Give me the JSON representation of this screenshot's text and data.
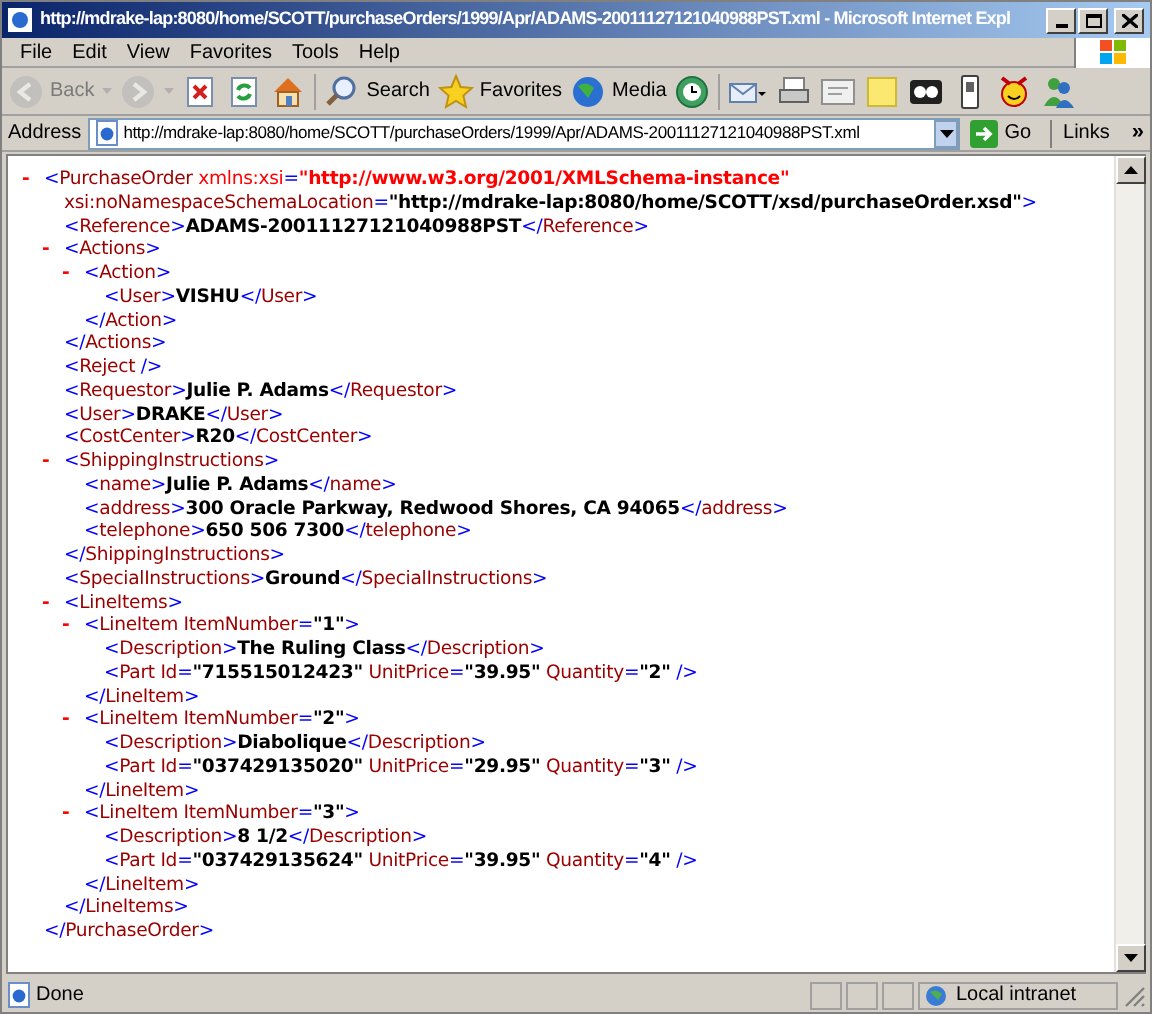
{
  "window": {
    "title": "http://mdrake-lap:8080/home/SCOTT/purchaseOrders/1999/Apr/ADAMS-20011127121040988PST.xml - Microsoft Internet Expl"
  },
  "menu": [
    "File",
    "Edit",
    "View",
    "Favorites",
    "Tools",
    "Help"
  ],
  "toolbar": [
    {
      "kind": "back",
      "label": "Back",
      "disabled": true
    },
    {
      "kind": "forward",
      "disabled": true
    },
    {
      "kind": "stop",
      "disabled": false
    },
    {
      "kind": "refresh",
      "disabled": false
    },
    {
      "kind": "home",
      "disabled": false
    },
    {
      "kind": "search",
      "label": "Search",
      "disabled": false
    },
    {
      "kind": "favorites",
      "label": "Favorites",
      "disabled": false
    },
    {
      "kind": "media",
      "label": "Media",
      "disabled": false
    },
    {
      "kind": "history",
      "disabled": false
    },
    {
      "kind": "mail",
      "disabled": false
    },
    {
      "kind": "print",
      "disabled": false
    },
    {
      "kind": "edit",
      "disabled": false
    },
    {
      "kind": "note",
      "disabled": false
    },
    {
      "kind": "glasses",
      "disabled": false
    },
    {
      "kind": "phone",
      "disabled": false
    },
    {
      "kind": "smiley",
      "disabled": false
    },
    {
      "kind": "messenger",
      "disabled": false
    }
  ],
  "address": {
    "label": "Address",
    "url": "http://mdrake-lap:8080/home/SCOTT/purchaseOrders/1999/Apr/ADAMS-20011127121040988PST.xml",
    "go": "Go",
    "links": "Links",
    "more": "»"
  },
  "document": {
    "toggle": "-",
    "open": [
      [
        {
          "kind": "b",
          "text": "<"
        },
        {
          "kind": "t",
          "text": "PurchaseOrder"
        },
        {
          "kind": "na",
          "text": " xmlns:xsi"
        },
        {
          "kind": "b",
          "text": "="
        },
        {
          "kind": "nv",
          "text": "\"http://www.w3.org/2001/XMLSchema-instance\""
        }
      ],
      [
        {
          "kind": "a",
          "text": "xsi:noNamespaceSchemaLocation"
        },
        {
          "kind": "b",
          "text": "="
        },
        {
          "kind": "v",
          "text": "\"http://mdrake-lap:8080/home/SCOTT/xsd/purchaseOrder.xsd\""
        },
        {
          "kind": "b",
          "text": ">"
        }
      ]
    ],
    "children": [
      {
        "open": [
          [
            {
              "kind": "b",
              "text": "<"
            },
            {
              "kind": "t",
              "text": "Reference"
            },
            {
              "kind": "b",
              "text": ">"
            },
            {
              "kind": "v",
              "text": "ADAMS-20011127121040988PST"
            },
            {
              "kind": "b",
              "text": "</"
            },
            {
              "kind": "t",
              "text": "Reference"
            },
            {
              "kind": "b",
              "text": ">"
            }
          ]
        ]
      },
      {
        "toggle": "-",
        "open": [
          [
            {
              "kind": "b",
              "text": "<"
            },
            {
              "kind": "t",
              "text": "Actions"
            },
            {
              "kind": "b",
              "text": ">"
            }
          ]
        ],
        "children": [
          {
            "toggle": "-",
            "open": [
              [
                {
                  "kind": "b",
                  "text": "<"
                },
                {
                  "kind": "t",
                  "text": "Action"
                },
                {
                  "kind": "b",
                  "text": ">"
                }
              ]
            ],
            "children": [
              {
                "open": [
                  [
                    {
                      "kind": "b",
                      "text": "<"
                    },
                    {
                      "kind": "t",
                      "text": "User"
                    },
                    {
                      "kind": "b",
                      "text": ">"
                    },
                    {
                      "kind": "v",
                      "text": "VISHU"
                    },
                    {
                      "kind": "b",
                      "text": "</"
                    },
                    {
                      "kind": "t",
                      "text": "User"
                    },
                    {
                      "kind": "b",
                      "text": ">"
                    }
                  ]
                ]
              }
            ],
            "close": [
              {
                "kind": "b",
                "text": "</"
              },
              {
                "kind": "t",
                "text": "Action"
              },
              {
                "kind": "b",
                "text": ">"
              }
            ]
          }
        ],
        "close": [
          {
            "kind": "b",
            "text": "</"
          },
          {
            "kind": "t",
            "text": "Actions"
          },
          {
            "kind": "b",
            "text": ">"
          }
        ]
      },
      {
        "open": [
          [
            {
              "kind": "b",
              "text": "<"
            },
            {
              "kind": "t",
              "text": "Reject"
            },
            {
              "kind": "b",
              "text": " />"
            }
          ]
        ]
      },
      {
        "open": [
          [
            {
              "kind": "b",
              "text": "<"
            },
            {
              "kind": "t",
              "text": "Requestor"
            },
            {
              "kind": "b",
              "text": ">"
            },
            {
              "kind": "v",
              "text": "Julie P. Adams"
            },
            {
              "kind": "b",
              "text": "</"
            },
            {
              "kind": "t",
              "text": "Requestor"
            },
            {
              "kind": "b",
              "text": ">"
            }
          ]
        ]
      },
      {
        "open": [
          [
            {
              "kind": "b",
              "text": "<"
            },
            {
              "kind": "t",
              "text": "User"
            },
            {
              "kind": "b",
              "text": ">"
            },
            {
              "kind": "v",
              "text": "DRAKE"
            },
            {
              "kind": "b",
              "text": "</"
            },
            {
              "kind": "t",
              "text": "User"
            },
            {
              "kind": "b",
              "text": ">"
            }
          ]
        ]
      },
      {
        "open": [
          [
            {
              "kind": "b",
              "text": "<"
            },
            {
              "kind": "t",
              "text": "CostCenter"
            },
            {
              "kind": "b",
              "text": ">"
            },
            {
              "kind": "v",
              "text": "R20"
            },
            {
              "kind": "b",
              "text": "</"
            },
            {
              "kind": "t",
              "text": "CostCenter"
            },
            {
              "kind": "b",
              "text": ">"
            }
          ]
        ]
      },
      {
        "toggle": "-",
        "open": [
          [
            {
              "kind": "b",
              "text": "<"
            },
            {
              "kind": "t",
              "text": "ShippingInstructions"
            },
            {
              "kind": "b",
              "text": ">"
            }
          ]
        ],
        "children": [
          {
            "open": [
              [
                {
                  "kind": "b",
                  "text": "<"
                },
                {
                  "kind": "t",
                  "text": "name"
                },
                {
                  "kind": "b",
                  "text": ">"
                },
                {
                  "kind": "v",
                  "text": "Julie P. Adams"
                },
                {
                  "kind": "b",
                  "text": "</"
                },
                {
                  "kind": "t",
                  "text": "name"
                },
                {
                  "kind": "b",
                  "text": ">"
                }
              ]
            ]
          },
          {
            "open": [
              [
                {
                  "kind": "b",
                  "text": "<"
                },
                {
                  "kind": "t",
                  "text": "address"
                },
                {
                  "kind": "b",
                  "text": ">"
                },
                {
                  "kind": "v",
                  "text": "300 Oracle Parkway, Redwood Shores, CA 94065"
                },
                {
                  "kind": "b",
                  "text": "</"
                },
                {
                  "kind": "t",
                  "text": "address"
                },
                {
                  "kind": "b",
                  "text": ">"
                }
              ]
            ]
          },
          {
            "open": [
              [
                {
                  "kind": "b",
                  "text": "<"
                },
                {
                  "kind": "t",
                  "text": "telephone"
                },
                {
                  "kind": "b",
                  "text": ">"
                },
                {
                  "kind": "v",
                  "text": "650 506 7300"
                },
                {
                  "kind": "b",
                  "text": "</"
                },
                {
                  "kind": "t",
                  "text": "telephone"
                },
                {
                  "kind": "b",
                  "text": ">"
                }
              ]
            ]
          }
        ],
        "close": [
          {
            "kind": "b",
            "text": "</"
          },
          {
            "kind": "t",
            "text": "ShippingInstructions"
          },
          {
            "kind": "b",
            "text": ">"
          }
        ]
      },
      {
        "open": [
          [
            {
              "kind": "b",
              "text": "<"
            },
            {
              "kind": "t",
              "text": "SpecialInstructions"
            },
            {
              "kind": "b",
              "text": ">"
            },
            {
              "kind": "v",
              "text": "Ground"
            },
            {
              "kind": "b",
              "text": "</"
            },
            {
              "kind": "t",
              "text": "SpecialInstructions"
            },
            {
              "kind": "b",
              "text": ">"
            }
          ]
        ]
      },
      {
        "toggle": "-",
        "open": [
          [
            {
              "kind": "b",
              "text": "<"
            },
            {
              "kind": "t",
              "text": "LineItems"
            },
            {
              "kind": "b",
              "text": ">"
            }
          ]
        ],
        "children": [
          {
            "toggle": "-",
            "open": [
              [
                {
                  "kind": "b",
                  "text": "<"
                },
                {
                  "kind": "t",
                  "text": "LineItem"
                },
                {
                  "kind": "a",
                  "text": " ItemNumber"
                },
                {
                  "kind": "b",
                  "text": "="
                },
                {
                  "kind": "v",
                  "text": "\"1\""
                },
                {
                  "kind": "b",
                  "text": ">"
                }
              ]
            ],
            "children": [
              {
                "open": [
                  [
                    {
                      "kind": "b",
                      "text": "<"
                    },
                    {
                      "kind": "t",
                      "text": "Description"
                    },
                    {
                      "kind": "b",
                      "text": ">"
                    },
                    {
                      "kind": "v",
                      "text": "The Ruling Class"
                    },
                    {
                      "kind": "b",
                      "text": "</"
                    },
                    {
                      "kind": "t",
                      "text": "Description"
                    },
                    {
                      "kind": "b",
                      "text": ">"
                    }
                  ]
                ]
              },
              {
                "open": [
                  [
                    {
                      "kind": "b",
                      "text": "<"
                    },
                    {
                      "kind": "t",
                      "text": "Part"
                    },
                    {
                      "kind": "a",
                      "text": " Id"
                    },
                    {
                      "kind": "b",
                      "text": "="
                    },
                    {
                      "kind": "v",
                      "text": "\"715515012423\""
                    },
                    {
                      "kind": "a",
                      "text": " UnitPrice"
                    },
                    {
                      "kind": "b",
                      "text": "="
                    },
                    {
                      "kind": "v",
                      "text": "\"39.95\""
                    },
                    {
                      "kind": "a",
                      "text": " Quantity"
                    },
                    {
                      "kind": "b",
                      "text": "="
                    },
                    {
                      "kind": "v",
                      "text": "\"2\""
                    },
                    {
                      "kind": "b",
                      "text": " />"
                    }
                  ]
                ]
              }
            ],
            "close": [
              {
                "kind": "b",
                "text": "</"
              },
              {
                "kind": "t",
                "text": "LineItem"
              },
              {
                "kind": "b",
                "text": ">"
              }
            ]
          },
          {
            "toggle": "-",
            "open": [
              [
                {
                  "kind": "b",
                  "text": "<"
                },
                {
                  "kind": "t",
                  "text": "LineItem"
                },
                {
                  "kind": "a",
                  "text": " ItemNumber"
                },
                {
                  "kind": "b",
                  "text": "="
                },
                {
                  "kind": "v",
                  "text": "\"2\""
                },
                {
                  "kind": "b",
                  "text": ">"
                }
              ]
            ],
            "children": [
              {
                "open": [
                  [
                    {
                      "kind": "b",
                      "text": "<"
                    },
                    {
                      "kind": "t",
                      "text": "Description"
                    },
                    {
                      "kind": "b",
                      "text": ">"
                    },
                    {
                      "kind": "v",
                      "text": "Diabolique"
                    },
                    {
                      "kind": "b",
                      "text": "</"
                    },
                    {
                      "kind": "t",
                      "text": "Description"
                    },
                    {
                      "kind": "b",
                      "text": ">"
                    }
                  ]
                ]
              },
              {
                "open": [
                  [
                    {
                      "kind": "b",
                      "text": "<"
                    },
                    {
                      "kind": "t",
                      "text": "Part"
                    },
                    {
                      "kind": "a",
                      "text": " Id"
                    },
                    {
                      "kind": "b",
                      "text": "="
                    },
                    {
                      "kind": "v",
                      "text": "\"037429135020\""
                    },
                    {
                      "kind": "a",
                      "text": " UnitPrice"
                    },
                    {
                      "kind": "b",
                      "text": "="
                    },
                    {
                      "kind": "v",
                      "text": "\"29.95\""
                    },
                    {
                      "kind": "a",
                      "text": " Quantity"
                    },
                    {
                      "kind": "b",
                      "text": "="
                    },
                    {
                      "kind": "v",
                      "text": "\"3\""
                    },
                    {
                      "kind": "b",
                      "text": " />"
                    }
                  ]
                ]
              }
            ],
            "close": [
              {
                "kind": "b",
                "text": "</"
              },
              {
                "kind": "t",
                "text": "LineItem"
              },
              {
                "kind": "b",
                "text": ">"
              }
            ]
          },
          {
            "toggle": "-",
            "open": [
              [
                {
                  "kind": "b",
                  "text": "<"
                },
                {
                  "kind": "t",
                  "text": "LineItem"
                },
                {
                  "kind": "a",
                  "text": " ItemNumber"
                },
                {
                  "kind": "b",
                  "text": "="
                },
                {
                  "kind": "v",
                  "text": "\"3\""
                },
                {
                  "kind": "b",
                  "text": ">"
                }
              ]
            ],
            "children": [
              {
                "open": [
                  [
                    {
                      "kind": "b",
                      "text": "<"
                    },
                    {
                      "kind": "t",
                      "text": "Description"
                    },
                    {
                      "kind": "b",
                      "text": ">"
                    },
                    {
                      "kind": "v",
                      "text": "8 1/2"
                    },
                    {
                      "kind": "b",
                      "text": "</"
                    },
                    {
                      "kind": "t",
                      "text": "Description"
                    },
                    {
                      "kind": "b",
                      "text": ">"
                    }
                  ]
                ]
              },
              {
                "open": [
                  [
                    {
                      "kind": "b",
                      "text": "<"
                    },
                    {
                      "kind": "t",
                      "text": "Part"
                    },
                    {
                      "kind": "a",
                      "text": " Id"
                    },
                    {
                      "kind": "b",
                      "text": "="
                    },
                    {
                      "kind": "v",
                      "text": "\"037429135624\""
                    },
                    {
                      "kind": "a",
                      "text": " UnitPrice"
                    },
                    {
                      "kind": "b",
                      "text": "="
                    },
                    {
                      "kind": "v",
                      "text": "\"39.95\""
                    },
                    {
                      "kind": "a",
                      "text": " Quantity"
                    },
                    {
                      "kind": "b",
                      "text": "="
                    },
                    {
                      "kind": "v",
                      "text": "\"4\""
                    },
                    {
                      "kind": "b",
                      "text": " />"
                    }
                  ]
                ]
              }
            ],
            "close": [
              {
                "kind": "b",
                "text": "</"
              },
              {
                "kind": "t",
                "text": "LineItem"
              },
              {
                "kind": "b",
                "text": ">"
              }
            ]
          }
        ],
        "close": [
          {
            "kind": "b",
            "text": "</"
          },
          {
            "kind": "t",
            "text": "LineItems"
          },
          {
            "kind": "b",
            "text": ">"
          }
        ]
      }
    ],
    "close": [
      {
        "kind": "b",
        "text": "</"
      },
      {
        "kind": "t",
        "text": "PurchaseOrder"
      },
      {
        "kind": "b",
        "text": ">"
      }
    ]
  },
  "status_bar": {
    "text": "Done",
    "zone": "Local intranet"
  }
}
